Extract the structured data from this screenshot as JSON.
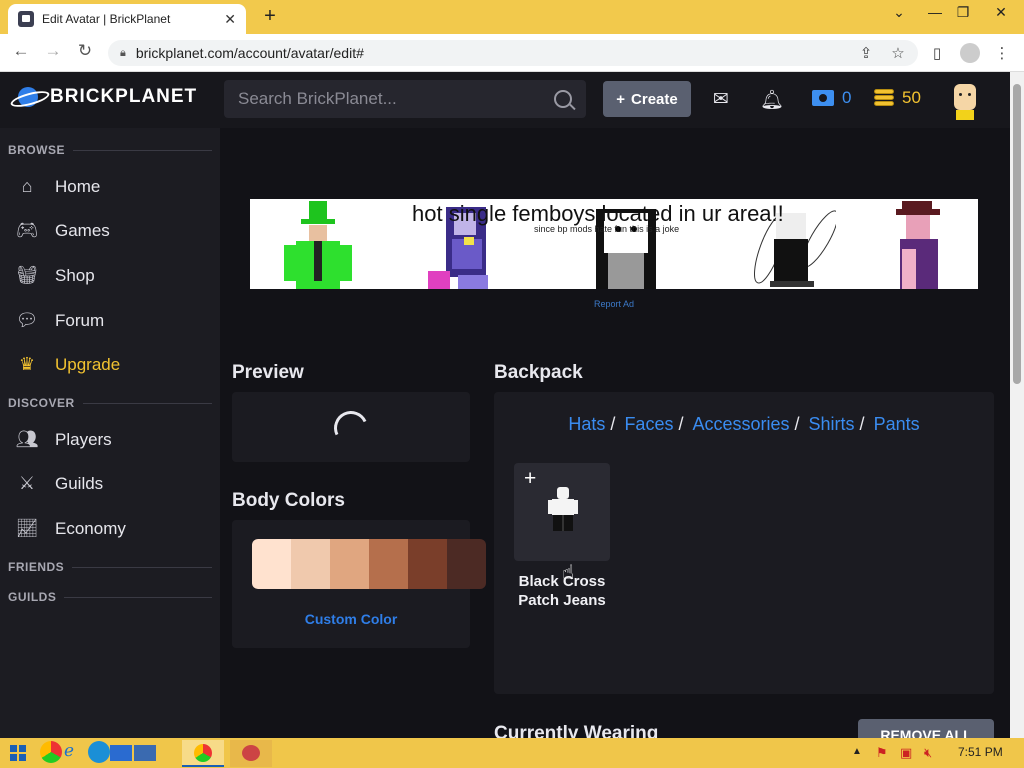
{
  "browser": {
    "tab_title": "Edit Avatar | BrickPlanet",
    "tab_close": "✕",
    "new_tab": "+",
    "url": "brickplanet.com/account/avatar/edit#",
    "window_controls": [
      "⌄",
      "—",
      "❐",
      "✕"
    ]
  },
  "header": {
    "logo_text": "BRICKPLANET",
    "search_placeholder": "Search BrickPlanet...",
    "create_label": "Create",
    "bucks": "0",
    "bits": "50"
  },
  "sidebar": {
    "browse_label": "BROWSE",
    "discover_label": "DISCOVER",
    "friends_label": "FRIENDS",
    "guilds_label": "GUILDS",
    "browse_items": [
      {
        "label": "Home",
        "icon": "home-icon"
      },
      {
        "label": "Games",
        "icon": "gamepad-icon"
      },
      {
        "label": "Shop",
        "icon": "basket-icon"
      },
      {
        "label": "Forum",
        "icon": "comments-icon"
      },
      {
        "label": "Upgrade",
        "icon": "crown-icon"
      }
    ],
    "discover_items": [
      {
        "label": "Players",
        "icon": "users-icon"
      },
      {
        "label": "Guilds",
        "icon": "swords-icon"
      },
      {
        "label": "Economy",
        "icon": "chart-icon"
      }
    ]
  },
  "ad": {
    "headline": "hot single femboys located in ur area!!",
    "subtext": "since bp mods hate fun this is a joke",
    "report_label": "Report Ad"
  },
  "preview": {
    "title": "Preview"
  },
  "body_colors": {
    "title": "Body Colors",
    "swatches": [
      "#ffe2cf",
      "#f0c9ad",
      "#e0a680",
      "#b56f4c",
      "#7a3e2a",
      "#4c2a24"
    ],
    "custom_label": "Custom Color"
  },
  "backpack": {
    "title": "Backpack",
    "categories": [
      "Hats",
      "Faces",
      "Accessories",
      "Shirts",
      "Pants"
    ],
    "separator": "/",
    "item": {
      "name": "Black Cross Patch Jeans",
      "add": "+"
    }
  },
  "wearing": {
    "title": "Currently Wearing",
    "remove_all_label": "REMOVE ALL"
  },
  "taskbar": {
    "time": "7:51 PM"
  },
  "colors": {
    "accent_blue": "#2f7ee8",
    "gold": "#f2c230",
    "bg": "#121217"
  }
}
